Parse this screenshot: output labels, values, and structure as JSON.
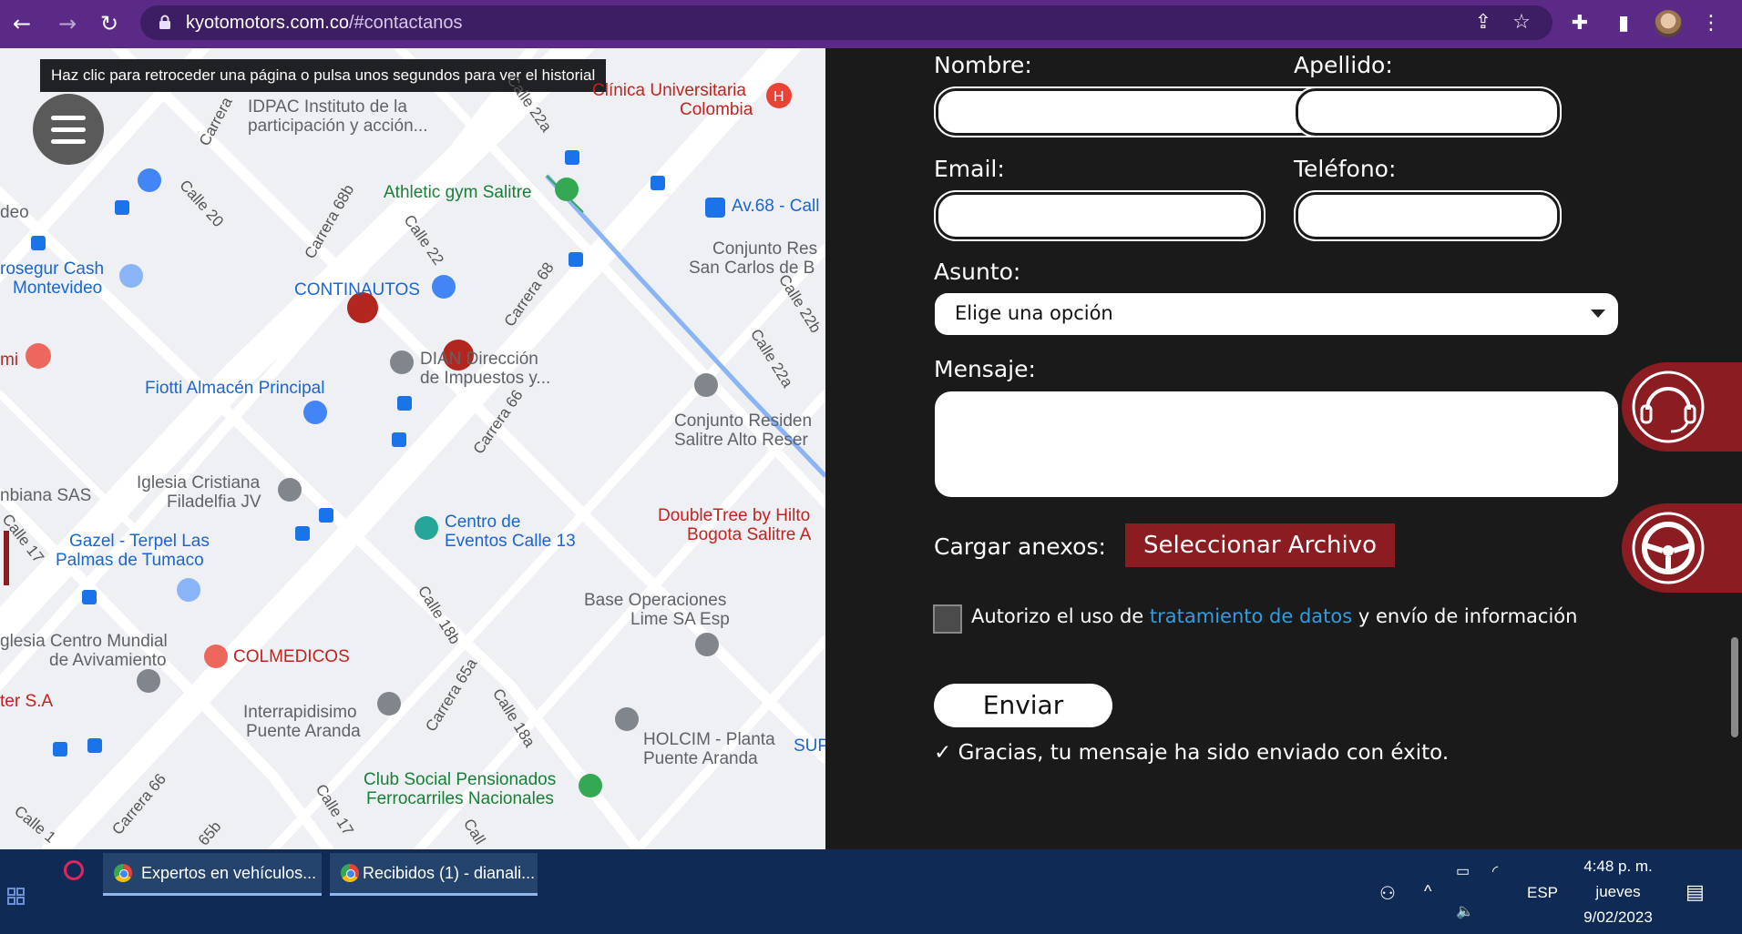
{
  "browser": {
    "url_host": "kyotomotors.com.co",
    "url_path": "/#contactanos"
  },
  "tooltip": "Haz clic para retroceder una página o pulsa unos segundos para ver el historial",
  "map": {
    "labels": [
      {
        "text": "IDPAC Instituto de la",
        "cls": "gray"
      },
      {
        "text": "participación y acción...",
        "cls": "gray"
      },
      {
        "text": "Clínica Universitaria",
        "cls": "pink"
      },
      {
        "text": "Colombia",
        "cls": "pink"
      },
      {
        "text": "Athletic gym Salitre",
        "cls": "green"
      },
      {
        "text": "Av.68 - Call",
        "cls": "blue"
      },
      {
        "text": "Conjunto Res",
        "cls": "gray"
      },
      {
        "text": "San Carlos de B",
        "cls": "gray"
      },
      {
        "text": "rosegur Cash",
        "cls": "blue"
      },
      {
        "text": "Montevideo",
        "cls": "blue"
      },
      {
        "text": "CONTINAUTOS",
        "cls": "blue"
      },
      {
        "text": "DIAN Dirección",
        "cls": "gray"
      },
      {
        "text": "de Impuestos y...",
        "cls": "gray"
      },
      {
        "text": "Fiotti Almacén Principal",
        "cls": "blue"
      },
      {
        "text": "Conjunto Residen",
        "cls": "gray"
      },
      {
        "text": "Salitre Alto Reser",
        "cls": "gray"
      },
      {
        "text": "Iglesia Cristiana",
        "cls": "gray"
      },
      {
        "text": "Filadelfia JV",
        "cls": "gray"
      },
      {
        "text": "nbiana SAS",
        "cls": "gray"
      },
      {
        "text": "Centro de",
        "cls": "blue"
      },
      {
        "text": "Eventos Calle 13",
        "cls": "blue"
      },
      {
        "text": "DoubleTree by Hilto",
        "cls": "pink"
      },
      {
        "text": "Bogota Salitre A",
        "cls": "pink"
      },
      {
        "text": "Gazel - Terpel Las",
        "cls": "blue"
      },
      {
        "text": "Palmas de Tumaco",
        "cls": "blue"
      },
      {
        "text": "Base Operaciones",
        "cls": "gray"
      },
      {
        "text": "Lime SA Esp",
        "cls": "gray"
      },
      {
        "text": "glesia Centro Mundial",
        "cls": "gray"
      },
      {
        "text": "de Avivamiento",
        "cls": "gray"
      },
      {
        "text": "COLMEDICOS",
        "cls": "pink"
      },
      {
        "text": "ter S.A",
        "cls": "pink"
      },
      {
        "text": "Interrapidisimo",
        "cls": "gray"
      },
      {
        "text": "Puente Aranda",
        "cls": "gray"
      },
      {
        "text": "HOLCIM - Planta",
        "cls": "gray"
      },
      {
        "text": "Puente Aranda",
        "cls": "gray"
      },
      {
        "text": "SUP",
        "cls": "blue"
      },
      {
        "text": "Club Social Pensionados",
        "cls": "green"
      },
      {
        "text": "Ferrocarriles Nacionales",
        "cls": "green"
      },
      {
        "text": "deo",
        "cls": "gray"
      },
      {
        "text": "mi",
        "cls": "pink"
      }
    ],
    "roads": [
      "Carrera",
      "Calle 20",
      "Calle 22a",
      "Carrera 68b",
      "Calle 22",
      "Carrera 68",
      "Calle 22b",
      "Calle 22a",
      "Carrera 66",
      "Calle 17",
      "Calle 18b",
      "Carrera 65a",
      "Calle 18a",
      "Carrera 66",
      "Calle 17",
      "Calle 1",
      "Call",
      "65b"
    ]
  },
  "form": {
    "nombre_label": "Nombre:",
    "apellido_label": "Apellido:",
    "email_label": "Email:",
    "telefono_label": "Teléfono:",
    "asunto_label": "Asunto:",
    "asunto_value": "Elige una opción",
    "mensaje_label": "Mensaje:",
    "anexos_label": "Cargar anexos:",
    "file_button": "Seleccionar Archivo",
    "consent_pre": "Autorizo el uso de",
    "consent_link": "tratamiento de datos",
    "consent_post": "y envío de información",
    "send_button": "Enviar",
    "success_message": "Gracias, tu mensaje ha sido enviado con éxito."
  },
  "taskbar": {
    "app1": "Expertos en vehículos...",
    "app2": "Recibidos (1) - dianali...",
    "language": "ESP",
    "time": "4:48 p. m.",
    "day": "jueves",
    "date": "9/02/2023"
  }
}
